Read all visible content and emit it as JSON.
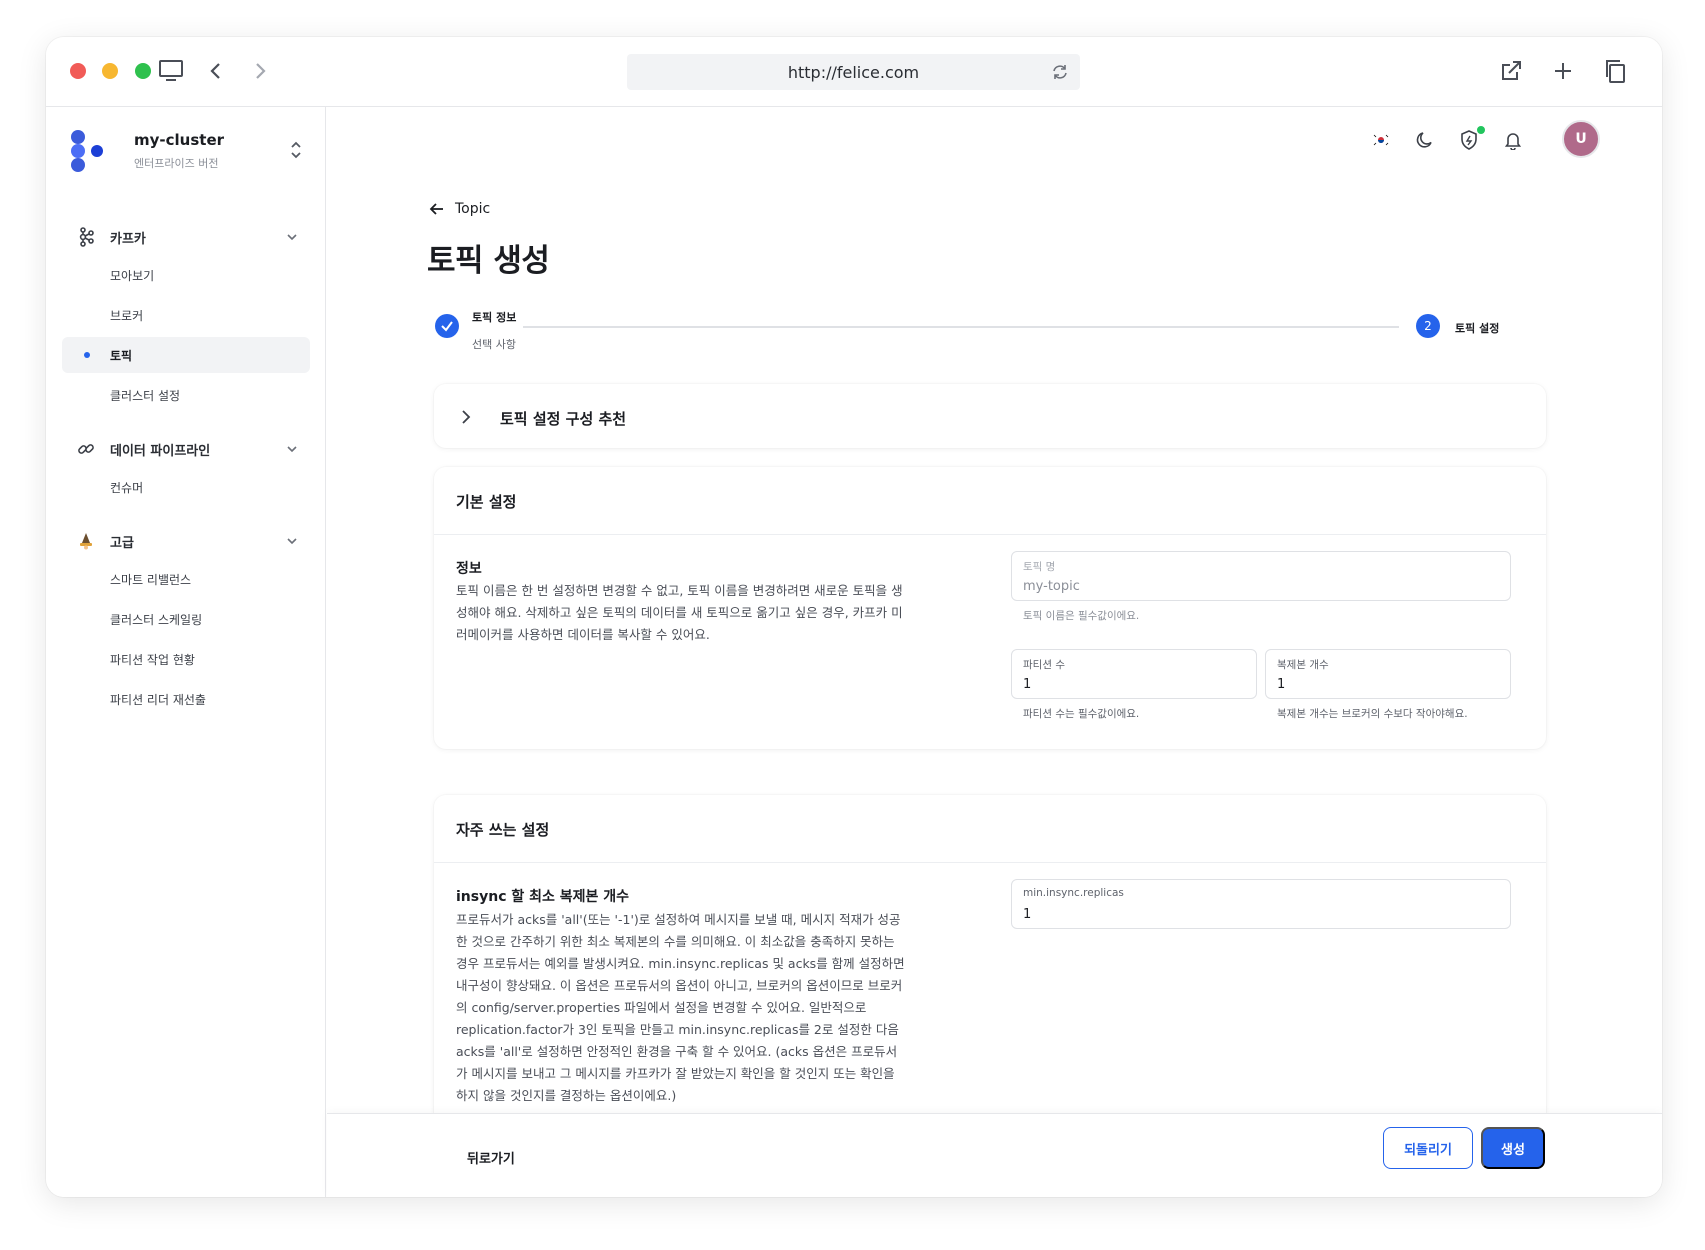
{
  "browser": {
    "url": "http://felice.com"
  },
  "sidebar": {
    "cluster_name": "my-cluster",
    "edition": "엔터프라이즈 버전",
    "groups": [
      {
        "label": "카프카",
        "icon": "kafka-icon",
        "items": [
          "모아보기",
          "브로커",
          "토픽",
          "클러스터 설정"
        ],
        "active_index": 2
      },
      {
        "label": "데이터 파이프라인",
        "icon": "link-icon",
        "items": [
          "컨슈머"
        ]
      },
      {
        "label": "고급",
        "icon": "wizard-icon",
        "items": [
          "스마트 리밸런스",
          "클러스터 스케일링",
          "파티션 작업 현황",
          "파티션 리더 재선출"
        ]
      }
    ]
  },
  "header": {
    "avatar_initial": "U",
    "language_flag": "korea-flag-icon"
  },
  "page": {
    "back_label": "Topic",
    "title": "토픽 생성"
  },
  "stepper": {
    "step1": {
      "title": "토픽 정보",
      "subtitle": "선택 사항",
      "status": "complete"
    },
    "step2": {
      "number": "2",
      "title": "토픽 설정",
      "status": "current"
    }
  },
  "recommend_card": {
    "title": "토픽 설정 구성 추천"
  },
  "basic_card": {
    "title": "기본 설정",
    "section_title": "정보",
    "section_desc": "토픽 이름은 한 번 설정하면 변경할 수 없고, 토픽 이름을 변경하려면 새로운 토픽을 생성해야 해요. 삭제하고 싶은 토픽의 데이터를 새 토픽으로 옮기고 싶은 경우, 카프카 미러메이커를 사용하면 데이터를 복사할 수 있어요.",
    "topic_name": {
      "label": "토픽 명",
      "value": "my-topic",
      "helper": "토픽 이름은 필수값이에요."
    },
    "partitions": {
      "label": "파티션 수",
      "value": "1",
      "helper": "파티션 수는 필수값이에요."
    },
    "replicas": {
      "label": "복제본 개수",
      "value": "1",
      "helper": "복제본 개수는 브로커의 수보다 작아야해요."
    }
  },
  "frequent_card": {
    "title": "자주 쓰는 설정",
    "section_title": "insync 할 최소 복제본 개수",
    "section_desc": "프로듀서가 acks를 'all'(또는 '-1')로 설정하여 메시지를 보낼 때, 메시지 적재가 성공한 것으로 간주하기 위한 최소 복제본의 수를 의미해요. 이 최소값을 충족하지 못하는 경우 프로듀서는 예외를 발생시켜요. min.insync.replicas 및 acks를 함께 설정하면 내구성이 향상돼요. 이 옵션은 프로듀서의 옵션이 아니고, 브로커의 옵션이므로 브로커의 config/server.properties 파일에서 설정을 변경할 수 있어요. 일반적으로 replication.factor가 3인 토픽을 만들고 min.insync.replicas를 2로 설정한 다음 acks를 'all'로 설정하면 안정적인 환경을 구축 할 수 있어요. (acks 옵션은 프로듀서가 메시지를 보내고 그 메시지를 카프카가 잘 받았는지 확인을 할 것인지 또는 확인을 하지 않을 것인지를 결정하는 옵션이에요.)",
    "min_insync": {
      "label": "min.insync.replicas",
      "value": "1"
    }
  },
  "footer": {
    "back_label": "뒤로가기",
    "reset_label": "되돌리기",
    "create_label": "생성"
  },
  "colors": {
    "accent": "#2563eb",
    "avatar": "#b06a8a",
    "status_dot": "#22c55e"
  }
}
